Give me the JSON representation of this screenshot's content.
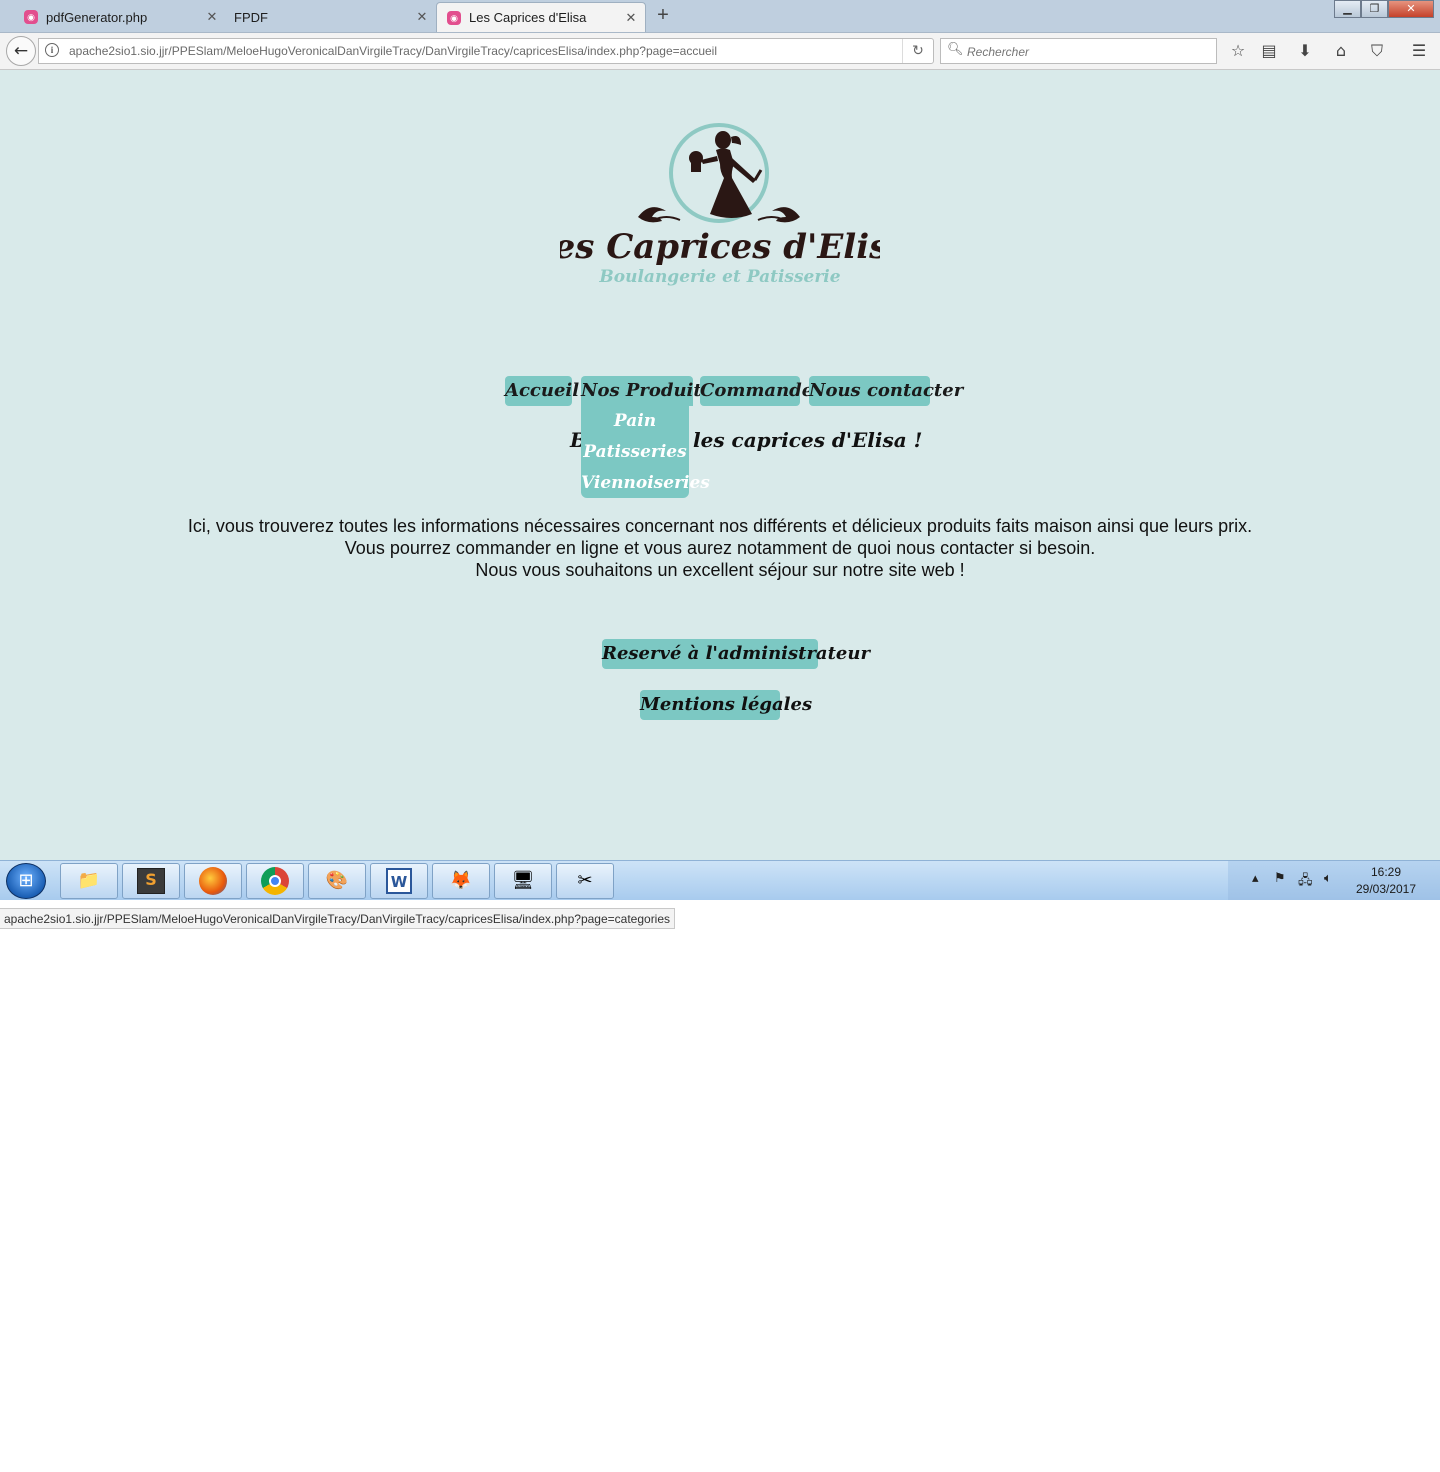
{
  "browser": {
    "tabs": [
      {
        "label": "pdfGenerator.php",
        "active": false
      },
      {
        "label": "FPDF",
        "active": false
      },
      {
        "label": "Les Caprices d'Elisa",
        "active": true
      }
    ],
    "new_tab_glyph": "+",
    "url": "apache2sio1.sio.jjr/PPESlam/MeloeHugoVeronicalDanVirgileTracy/DanVirgileTracy/capricesElisa/index.php?page=accueil",
    "search_placeholder": "Rechercher",
    "toolbar_icons": [
      "star-icon",
      "reading-list-icon",
      "download-icon",
      "home-icon",
      "pocket-icon",
      "menu-icon"
    ],
    "status_url": "apache2sio1.sio.jjr/PPESlam/MeloeHugoVeronicalDanVirgileTracy/DanVirgileTracy/capricesElisa/index.php?page=categories"
  },
  "site": {
    "logo": {
      "title": "Les Caprices d'Elisa",
      "subtitle": "Boulangerie et Patisserie"
    },
    "menu": {
      "home": "Accueil",
      "products": "Nos Produits",
      "order": "Commander",
      "contact": "Nous contacter"
    },
    "submenu": {
      "bread": "Pain",
      "pastries": "Patisseries",
      "viennoiseries": "Viennoiseries"
    },
    "welcome_left": "B",
    "welcome_right": "les caprices d'Elisa !",
    "intro": [
      "Ici, vous trouverez toutes les informations nécessaires concernant nos différents et délicieux produits faits maison ainsi que leurs prix.",
      "Vous pourrez commander en ligne et vous aurez notamment de quoi nous contacter si besoin.",
      "Nous vous souhaitons un excellent séjour sur notre site web !"
    ],
    "admin_button": "Reservé à l'administrateur",
    "legal_button": "Mentions légales",
    "colors": {
      "background": "#d9eaea",
      "accent": "#7cc8c3",
      "logo_dark": "#2a1714",
      "logo_teal": "#8ec9c3"
    }
  },
  "taskbar": {
    "apps": [
      "explorer-icon",
      "sublime-text-icon",
      "firefox-icon",
      "chrome-icon",
      "paint-icon",
      "word-icon",
      "gimp-icon",
      "remote-desktop-icon",
      "snipping-tool-icon"
    ],
    "time": "16:29",
    "date": "29/03/2017"
  }
}
